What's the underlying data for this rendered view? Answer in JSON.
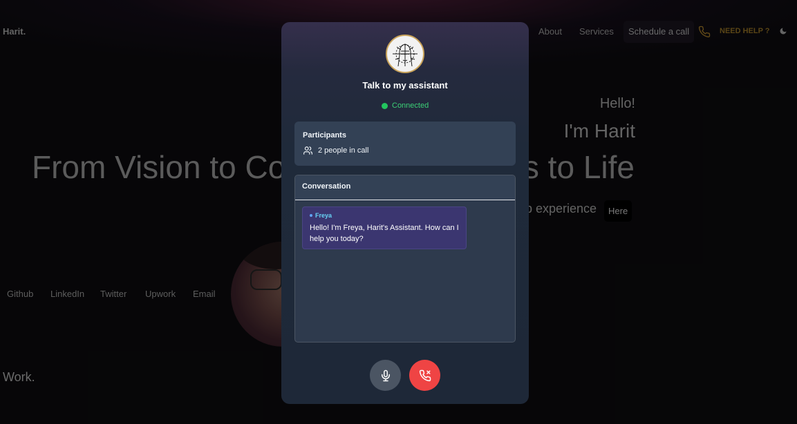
{
  "nav": {
    "brand": "Harit.",
    "about": "About",
    "services": "Services",
    "schedule": "Schedule a call",
    "need_help": "NEED HELP ?"
  },
  "hero": {
    "hello": "Hello!",
    "im": "I'm Harit",
    "title_left": "From Vision to Co",
    "title_right": "s to Life",
    "web_experience": "b experience",
    "here": "Here"
  },
  "social": [
    "Github",
    "LinkedIn",
    "Twitter",
    "Upwork",
    "Email"
  ],
  "work": "Work.",
  "modal": {
    "title": "Talk to my assistant",
    "status": "Connected",
    "participants_label": "Participants",
    "participants_count": "2 people in call",
    "conversation_label": "Conversation",
    "message": {
      "sender": "Freya",
      "text": "Hello! I'm Freya, Harit's Assistant. How can I help you today?"
    },
    "mic_icon": "microphone-icon",
    "end_icon": "phone-hangup-icon"
  },
  "colors": {
    "connected": "#22c55e",
    "end_call": "#ef4444",
    "mic": "#4b5563",
    "sender": "#67d3f5",
    "bubble": "#3b3670"
  }
}
